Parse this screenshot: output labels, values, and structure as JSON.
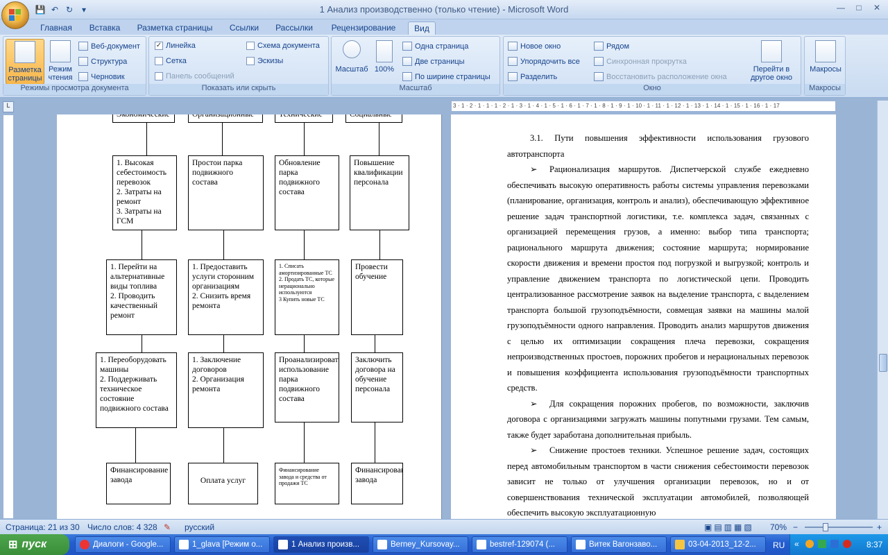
{
  "window": {
    "title": "1 Анализ производственно (только чтение) - Microsoft Word",
    "minimize": "—",
    "maximize": "□",
    "close": "✕"
  },
  "qat": {
    "save_icon": "save-icon",
    "undo_icon": "undo-icon",
    "redo_icon": "redo-icon",
    "more": "▾"
  },
  "tabs": [
    "Главная",
    "Вставка",
    "Разметка страницы",
    "Ссылки",
    "Рассылки",
    "Рецензирование",
    "Вид"
  ],
  "active_tab": "Вид",
  "ribbon": {
    "views": {
      "label": "Режимы просмотра документа",
      "print_layout": "Разметка страницы",
      "reading": "Режим чтения",
      "web": "Веб-документ",
      "outline": "Структура",
      "draft": "Черновик"
    },
    "show": {
      "label": "Показать или скрыть",
      "ruler": "Линейка",
      "grid": "Сетка",
      "message_bar": "Панель сообщений",
      "doc_map": "Схема документа",
      "thumbnails": "Эскизы"
    },
    "zoom": {
      "label": "Масштаб",
      "zoom": "Масштаб",
      "hundred": "100%",
      "one_page": "Одна страница",
      "two_pages": "Две страницы",
      "page_width": "По ширине страницы"
    },
    "window": {
      "label": "Окно",
      "new_window": "Новое окно",
      "arrange_all": "Упорядочить все",
      "split": "Разделить",
      "side_by_side": "Рядом",
      "sync_scroll": "Синхронная прокрутка",
      "reset_pos": "Восстановить расположение окна",
      "switch": "Перейти в другое окно"
    },
    "macros": {
      "label": "Макросы",
      "macros": "Макросы"
    }
  },
  "ruler_ticks": "3 · 1 · 2 · 1 · 1 · 1 · 2 · 1 · 3 · 1 · 4 · 1 · 5 · 1 · 6 · 1 · 7 · 1 · 8 · 1 · 9 · 1 · 10 · 1 · 11 · 1 · 12 · 1 · 13 · 1 · 14 · 1 · 15 · 1 · 16 · 1 · 17",
  "diagram": {
    "headers": [
      "Экономические",
      "Организационные",
      "Технические",
      "Социальные"
    ],
    "row1": [
      "1. Высокая себестоимость перевозок\n2. Затраты  на ремонт\n3. Затраты  на ГСМ",
      "Простои парка подвижного состава",
      "Обновление парка подвижного состава",
      "Повышение квалификации персонала"
    ],
    "row2": [
      "1. Перейти  на альтернативные виды топлива\n2. Проводить качественный ремонт",
      "1. Предоставить услуги сторонним организациям\n2. Снизить  время ремонта",
      "1. Списать амортизированные ТС\n2. Продать ТС, которые нерационально используются\n3 Купить новые ТС",
      "Провести обучение"
    ],
    "row3": [
      "1. Переоборудовать машины\n2. Поддерживать техническое состояние подвижного состава",
      "1. Заключение договоров\n2. Организация ремонта",
      "Проанализировать использование парка подвижного состава",
      "Заключить договора на обучение персонала"
    ],
    "row4": [
      "Финансирование завода",
      "Оплата услуг",
      "Финансирование завода и средства от  продажи ТС",
      "Финансирование завода"
    ]
  },
  "document": {
    "heading": "3.1.  Пути  повышения  эффективности  использования  грузового автотранспорта",
    "p1": "Рационализация маршрутов. Диспетчерской службе ежедневно обеспечивать высокую оперативность работы системы управления перевозками (планирование, организация, контроль и анализ), обеспечивающую эффективное решение задач транспортной логистики, т.е. комплекса задач, связанных с организацией перемещения грузов, а именно: выбор типа транспорта; рационального маршрута движения; состояние маршрута; нормирование скорости движения и времени простоя под погрузкой и выгрузкой; контроль и управление движением транспорта по логистической цепи. Проводить централизованное рассмотрение заявок на выделение транспорта, с выделением транспорта большой грузоподъёмности, совмещая заявки на машины малой грузоподъёмности одного направления. Проводить анализ маршрутов движения с целью их оптимизации сокращения плеча перевозки, сокращения непроизводственных простоев, порожних пробегов и нерациональных перевозок и повышения коэффициента использования грузоподъёмности транспортных средств.",
    "p2": "Для сокращения порожних пробегов, по возможности, заключив договора с организациями загружать машины попутными грузами. Тем самым, также будет заработана дополнительная прибыль.",
    "p3": "Снижение простоев техники. Успешное решение задач, состоящих перед автомобильным транспортом в части снижения себестоимости перевозок зависит не только от улучшения организации перевозок, но и от совершенствования технической эксплуатации автомобилей, позволяющей обеспечить высокую эксплуатационную",
    "bullet": "➢"
  },
  "status": {
    "page": "Страница: 21 из 30",
    "words": "Число слов: 4 328",
    "lang": "русский",
    "zoom": "70%",
    "zoom_minus": "−",
    "zoom_plus": "+"
  },
  "taskbar": {
    "start": "пуск",
    "tasks": [
      "Диалоги - Google...",
      "1_glava [Режим о...",
      "1 Анализ произв...",
      "Berney_Kursovay...",
      "bestref-129074 (...",
      "Витек Вагонзаво...",
      "03-04-2013_12-2..."
    ],
    "lang": "RU",
    "clock": "8:37"
  }
}
